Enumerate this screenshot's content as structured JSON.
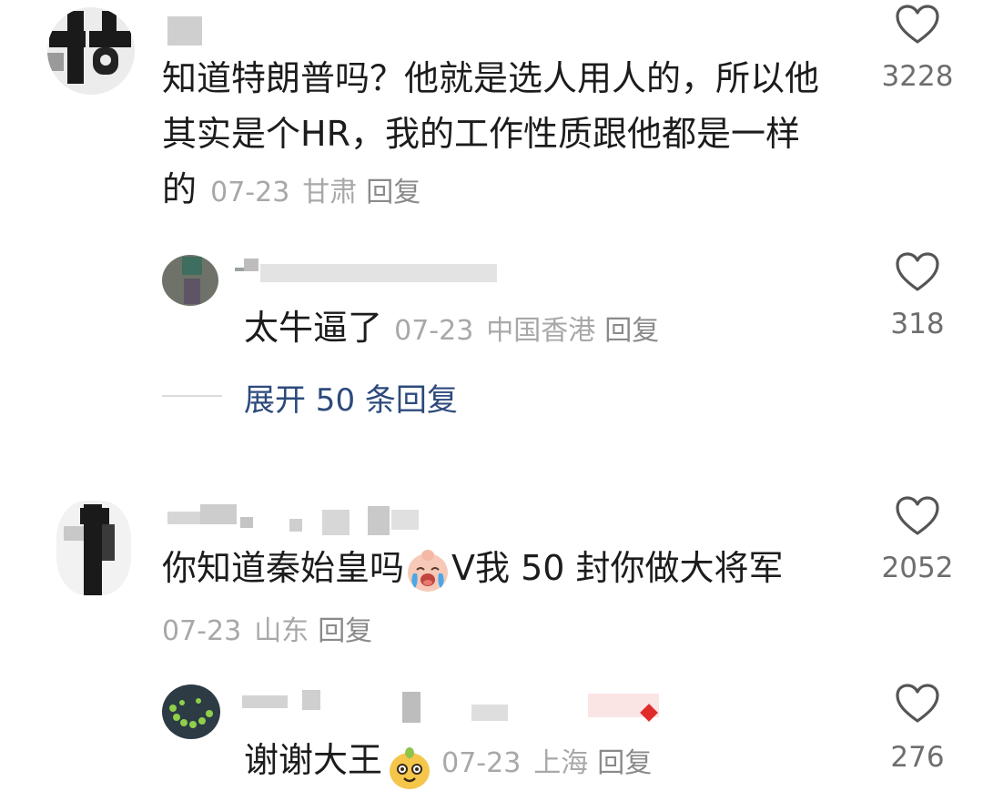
{
  "comments": [
    {
      "text_lines": [
        "知道特朗普吗？他就是选人用人的，所以他",
        "其实是个HR，我的工作性质跟他都是一样",
        "的"
      ],
      "date": "07-23",
      "location": "甘肃",
      "reply_label": "回复",
      "likes": "3228",
      "replies": [
        {
          "text": "太牛逼了",
          "date": "07-23",
          "location": "中国香港",
          "reply_label": "回复",
          "likes": "318"
        }
      ],
      "expand_label": "展开 50 条回复"
    },
    {
      "text_before_emoji": "你知道秦始皇吗",
      "text_after_emoji": "V我 50 封你做大将军",
      "date": "07-23",
      "location": "山东",
      "reply_label": "回复",
      "likes": "2052",
      "replies": [
        {
          "text": "谢谢大王",
          "date": "07-23",
          "location": "上海",
          "reply_label": "回复",
          "likes": "276"
        }
      ]
    }
  ],
  "icons": {
    "like": "heart-outline-icon",
    "emoji_cry": "crying-face-emoji",
    "emoji_dog": "dog-face-emoji"
  },
  "colors": {
    "text": "#1c1c1c",
    "meta": "#a8a8a8",
    "expand_link": "#2d4a7c",
    "heart_stroke": "#555555"
  }
}
